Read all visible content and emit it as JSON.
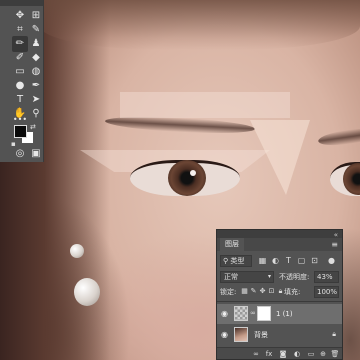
{
  "tools": {
    "icons": [
      "move-icon",
      "marquee-icon",
      "lasso-icon",
      "quick-select-icon",
      "crop-icon",
      "eyedropper-icon",
      "healing-brush-icon",
      "brush-icon",
      "clone-stamp-icon",
      "history-brush-icon",
      "eraser-icon",
      "gradient-icon",
      "blur-icon",
      "dodge-icon",
      "pen-icon",
      "type-icon",
      "path-select-icon",
      "shape-icon",
      "hand-icon",
      "zoom-icon",
      "more-tools-icon"
    ],
    "foreground_color": "#0a0a0a",
    "background_color": "#ffffff"
  },
  "layers_panel": {
    "tab_label": "图层",
    "filter_kind": "类型",
    "blend_mode": "正常",
    "opacity_label": "不透明度:",
    "opacity_value": "43%",
    "lock_label": "锁定:",
    "fill_label": "填充:",
    "fill_value": "100%",
    "layers": [
      {
        "name": "1 (1)",
        "visible": true,
        "selected": true,
        "has_mask": true,
        "locked": false
      },
      {
        "name": "背景",
        "visible": true,
        "selected": false,
        "has_mask": false,
        "locked": true
      }
    ]
  },
  "colors": {
    "panel_bg": "#535353",
    "selected_layer": "#6e6e6e",
    "panel_dark": "#3e3e3e"
  }
}
